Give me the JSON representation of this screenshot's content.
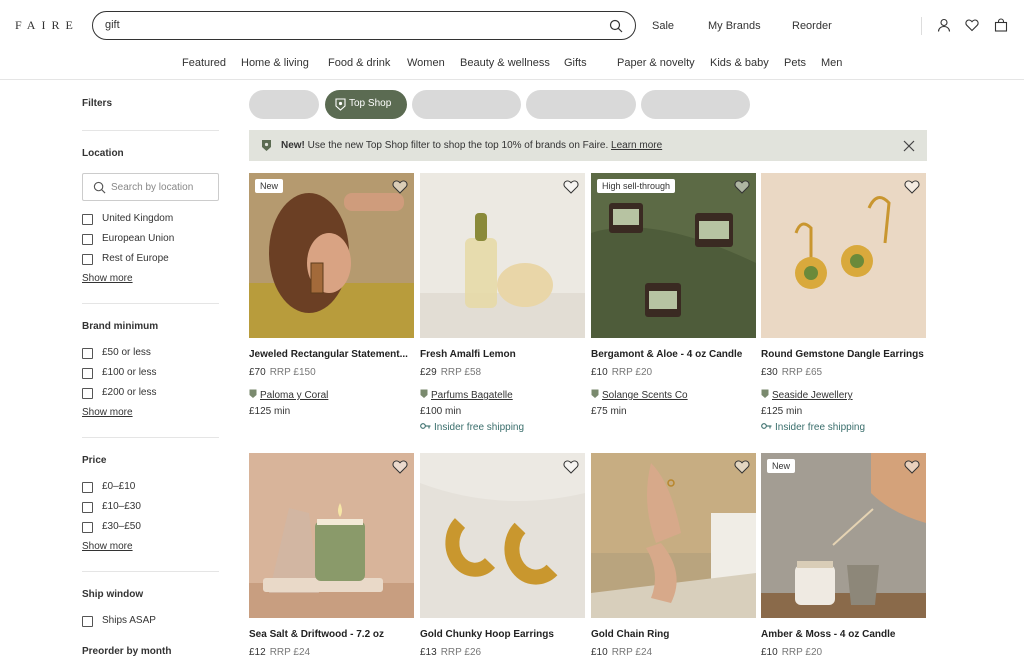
{
  "header": {
    "logo": "FAIRE",
    "search_value": "gift",
    "links": [
      "Sale",
      "My Brands",
      "Reorder"
    ]
  },
  "categories": [
    "Featured",
    "Home & living",
    "Food & drink",
    "Women",
    "Beauty & wellness",
    "Gifts",
    "Paper & novelty",
    "Kids & baby",
    "Pets",
    "Men"
  ],
  "sidebar": {
    "filters_title": "Filters",
    "location": {
      "title": "Location",
      "search_placeholder": "Search by location",
      "options": [
        "United Kingdom",
        "European Union",
        "Rest of Europe"
      ],
      "show_more": "Show more"
    },
    "brand_minimum": {
      "title": "Brand minimum",
      "options": [
        "£50 or less",
        "£100 or less",
        "£200 or less"
      ],
      "show_more": "Show more"
    },
    "price": {
      "title": "Price",
      "options": [
        "£0–£10",
        "£10–£30",
        "£30–£50"
      ],
      "show_more": "Show more"
    },
    "ship_window": {
      "title": "Ship window",
      "options": [
        "Ships ASAP"
      ]
    },
    "preorder": {
      "title": "Preorder by month"
    }
  },
  "chips": {
    "active_label": "Top Shop"
  },
  "banner": {
    "new": "New!",
    "text": " Use the new Top Shop filter to shop the top 10% of brands on Faire. ",
    "learn_more": "Learn more"
  },
  "products": [
    {
      "badge": "New",
      "name": "Jeweled Rectangular Statement...",
      "price": "£70",
      "rrp": "RRP £150",
      "brand": "Paloma y Coral",
      "min": "£125 min",
      "shipping": ""
    },
    {
      "badge": "",
      "name": "Fresh Amalfi Lemon",
      "price": "£29",
      "rrp": "RRP £58",
      "brand": "Parfums Bagatelle",
      "min": "£100 min",
      "shipping": "Insider free shipping"
    },
    {
      "badge": "High sell-through",
      "name": "Bergamont & Aloe - 4 oz Candle",
      "price": "£10",
      "rrp": "RRP £20",
      "brand": "Solange Scents Co",
      "min": "£75 min",
      "shipping": ""
    },
    {
      "badge": "",
      "name": "Round Gemstone Dangle Earrings",
      "price": "£30",
      "rrp": "RRP £65",
      "brand": "Seaside Jewellery",
      "min": "£125 min",
      "shipping": "Insider free shipping"
    },
    {
      "badge": "",
      "name": "Sea Salt & Driftwood - 7.2 oz",
      "price": "£12",
      "rrp": "RRP £24"
    },
    {
      "badge": "",
      "name": "Gold Chunky Hoop Earrings",
      "price": "£13",
      "rrp": "RRP £26"
    },
    {
      "badge": "",
      "name": "Gold Chain Ring",
      "price": "£10",
      "rrp": "RRP £24"
    },
    {
      "badge": "New",
      "name": "Amber & Moss - 4 oz Candle",
      "price": "£10",
      "rrp": "RRP £20"
    }
  ]
}
